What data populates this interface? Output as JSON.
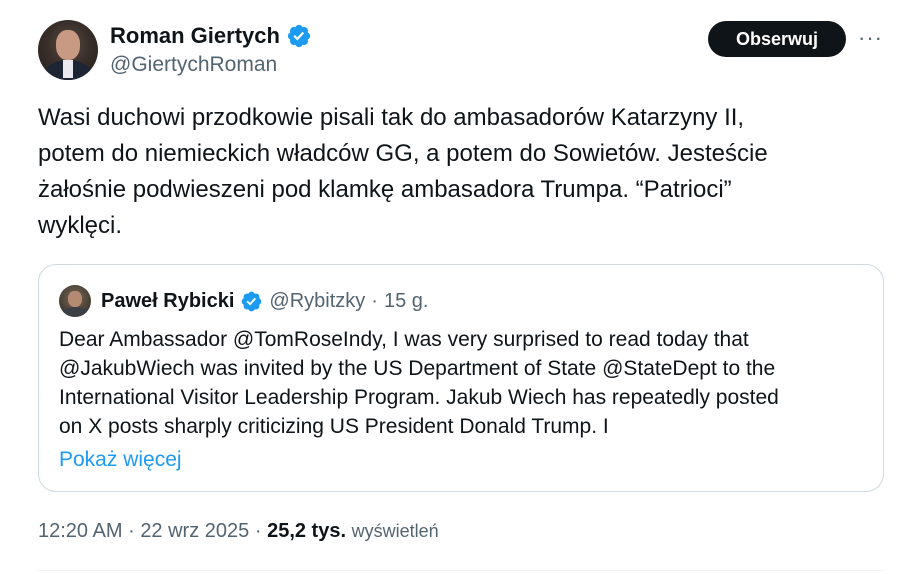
{
  "author": {
    "name": "Roman Giertych",
    "handle": "@GiertychRoman",
    "avatar_icon": "user-avatar-icon",
    "verified_icon": "verified-badge-icon"
  },
  "follow_button": {
    "label": "Obserwuj"
  },
  "more_icon": {
    "glyph": "···",
    "icon": "more-options-icon"
  },
  "tweet": {
    "lines": [
      "Wasi duchowi przodkowie pisali tak do ambasadorów Katarzyny II,",
      "potem do niemieckich władców GG, a potem do Sowietów. Jesteście",
      "żałośnie podwieszeni pod klamkę ambasadora Trumpa. “Patrioci”",
      "wyklęci."
    ]
  },
  "quote": {
    "name": "Paweł Rybicki",
    "handle": "@Rybitzky",
    "separator": "·",
    "time": "15 g.",
    "lines": [
      "Dear Ambassador @TomRoseIndy, I was very surprised to read today that",
      "@JakubWiech was invited by the US Department of State @StateDept to the",
      "International Visitor Leadership Program. Jakub Wiech has repeatedly posted",
      "on X posts sharply criticizing US President Donald Trump. I"
    ],
    "show_more": "Pokaż więcej"
  },
  "footer": {
    "time": "12:20 AM",
    "sep1": "·",
    "date": "22 wrz 2025",
    "sep2": "·",
    "views_count": "25,2 tys.",
    "views_label": "wyświetleń"
  },
  "colors": {
    "text": "#0f1419",
    "secondary": "#536471",
    "link": "#1d9bf0",
    "verified": "#1d9bf0",
    "border": "#cfd9de"
  }
}
